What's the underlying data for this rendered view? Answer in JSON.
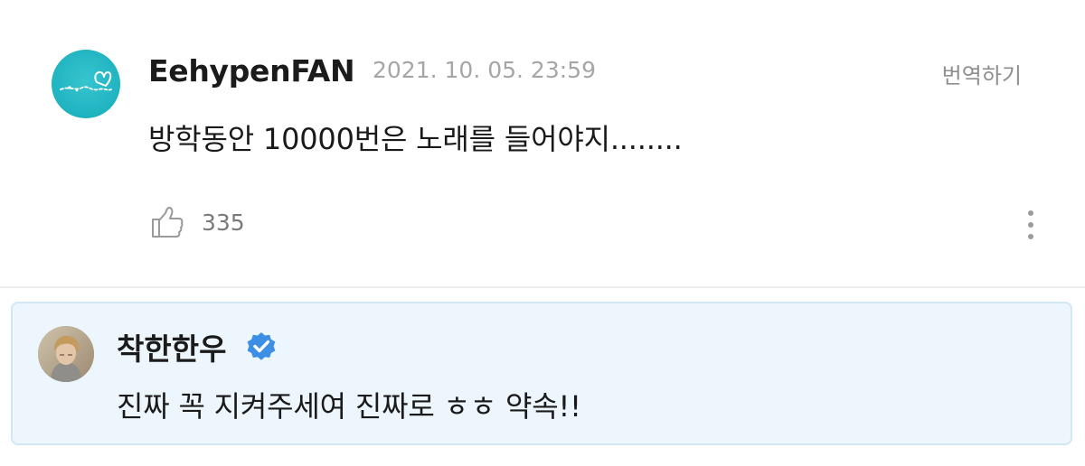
{
  "comment": {
    "author": "EehypenFAN",
    "date": "2021. 10. 05. 23:59",
    "translate_label": "번역하기",
    "text": "방학동안 10000번은 노래를 들어야지........",
    "like_count": "335",
    "icons": {
      "avatar": "fan-club-logo-icon",
      "like": "thumbs-up-icon",
      "more": "more-vertical-icon"
    }
  },
  "reply": {
    "author": "착한한우",
    "verified": true,
    "text": "진짜 꼭 지켜주세여 진짜로 ㅎㅎ 약속!!",
    "icons": {
      "avatar": "artist-avatar",
      "badge": "verified-badge-icon"
    }
  },
  "colors": {
    "reply_background": "#ecf6fc",
    "reply_border": "#d2e7f4",
    "verified_blue": "#3d8fe6",
    "fan_avatar_teal": "#1fb3c0",
    "meta_gray": "#a6a6a6"
  }
}
